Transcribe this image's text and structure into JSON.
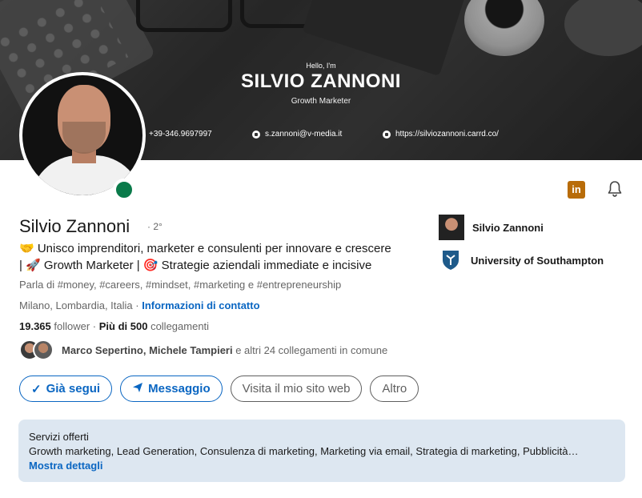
{
  "banner": {
    "greeting": "Hello, I'm",
    "name": "SILVIO ZANNONI",
    "role": "Growth Marketer",
    "phone": "+39-346.9697997",
    "email": "s.zannoni@v-media.it",
    "website": "https://silviozannoni.carrd.co/"
  },
  "profile": {
    "name": "Silvio Zannoni",
    "degree": "· 2°",
    "headline_line1": "🤝 Unisco imprenditori, marketer e consulenti per innovare e crescere",
    "headline_line2": "| 🚀 Growth Marketer | 🎯 Strategie aziendali immediate e incisive",
    "about": "Parla di #money, #careers, #mindset, #marketing e #entrepreneurship",
    "location": "Milano, Lombardia, Italia",
    "location_sep": " · ",
    "contact_link": "Informazioni di contatto",
    "followers": "19.365",
    "followers_label": " follower",
    "connections_sep": " · ",
    "connections": "Più di 500",
    "connections_label": " collegamenti",
    "mutual_names": "Marco Sepertino, Michele Tampieri",
    "mutual_rest": " e altri 24 collegamenti in comune"
  },
  "buttons": {
    "following": "Già segui",
    "message": "Messaggio",
    "website": "Visita il mio sito web",
    "more": "Altro"
  },
  "side": {
    "company": "Silvio Zannoni",
    "school": "University of Southampton"
  },
  "services": {
    "title": "Servizi offerti",
    "list": "Growth marketing, Lead Generation, Consulenza di marketing, Marketing via email, Strategia di marketing, Pubblicità…",
    "link": "Mostra dettagli"
  },
  "icons": {
    "linkedin": "in",
    "check": "✓",
    "send": "➤"
  },
  "colors": {
    "accent": "#0a66c2",
    "online": "#0a7a4a",
    "linkedin_badge": "#b86c09",
    "services_bg": "#dde7f1"
  }
}
